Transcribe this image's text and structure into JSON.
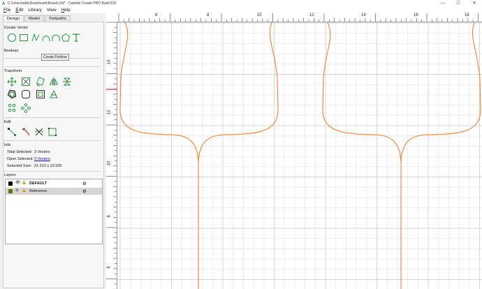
{
  "window": {
    "title": "C:\\Users\\wills\\Downloads\\Board.c2d* - Carbide Create PRO Build 815",
    "minimize_glyph": "—",
    "maximize_glyph": "☐",
    "close_glyph": "✕"
  },
  "menu": [
    {
      "mnemonic": "F",
      "rest": "ile"
    },
    {
      "mnemonic": "E",
      "rest": "dit"
    },
    {
      "mnemonic": "",
      "rest": "Library"
    },
    {
      "mnemonic": "",
      "rest": "View"
    },
    {
      "mnemonic": "H",
      "rest": "elp"
    }
  ],
  "tabs": [
    "Design",
    "Model",
    "Toolpaths"
  ],
  "sections": {
    "create_vector": "Create Vector",
    "boolean": "Boolean",
    "transform": "Transform",
    "edit": "Edit",
    "info": "Info",
    "layers": "Layers"
  },
  "tooltip": "Create Polyline",
  "info": {
    "total_selected_label": "Total Selected:",
    "total_selected_value": "3 Vectors",
    "open_selected_label": "Open Selected:",
    "open_selected_value": "3 Vectors",
    "selected_size_label": "Selected Size:",
    "selected_size_value": "21.313 x 13.555"
  },
  "layers": [
    {
      "name": "DEFAULT",
      "color": "#000000",
      "bold": true
    },
    {
      "name": "Reference",
      "color": "#6b6b00",
      "bold": false
    }
  ],
  "ruler": {
    "h_labels": [
      "6",
      "8",
      "10",
      "12",
      "14",
      "16",
      "18"
    ],
    "v_labels": [
      "14",
      "12",
      "10",
      "8",
      "6"
    ]
  },
  "colors": {
    "vector_stroke": "#ff7f27",
    "ui_icon_green": "#1f9d3a",
    "grid_minor": "#ececec",
    "grid_major": "#d4d4d4",
    "ruler_marker": "#cc0000"
  }
}
